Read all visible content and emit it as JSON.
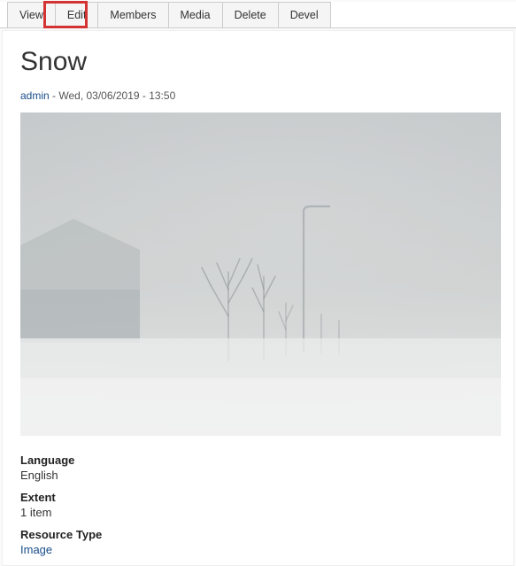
{
  "tabs": {
    "view": "View",
    "edit": "Edit",
    "members": "Members",
    "media": "Media",
    "delete": "Delete",
    "devel": "Devel"
  },
  "page": {
    "title": "Snow",
    "author": "admin",
    "byline_sep": " - ",
    "date": "Wed, 03/06/2019 - 13:50"
  },
  "meta": {
    "language_label": "Language",
    "language_value": "English",
    "extent_label": "Extent",
    "extent_value": "1 item",
    "resource_type_label": "Resource Type",
    "resource_type_value": "Image"
  }
}
